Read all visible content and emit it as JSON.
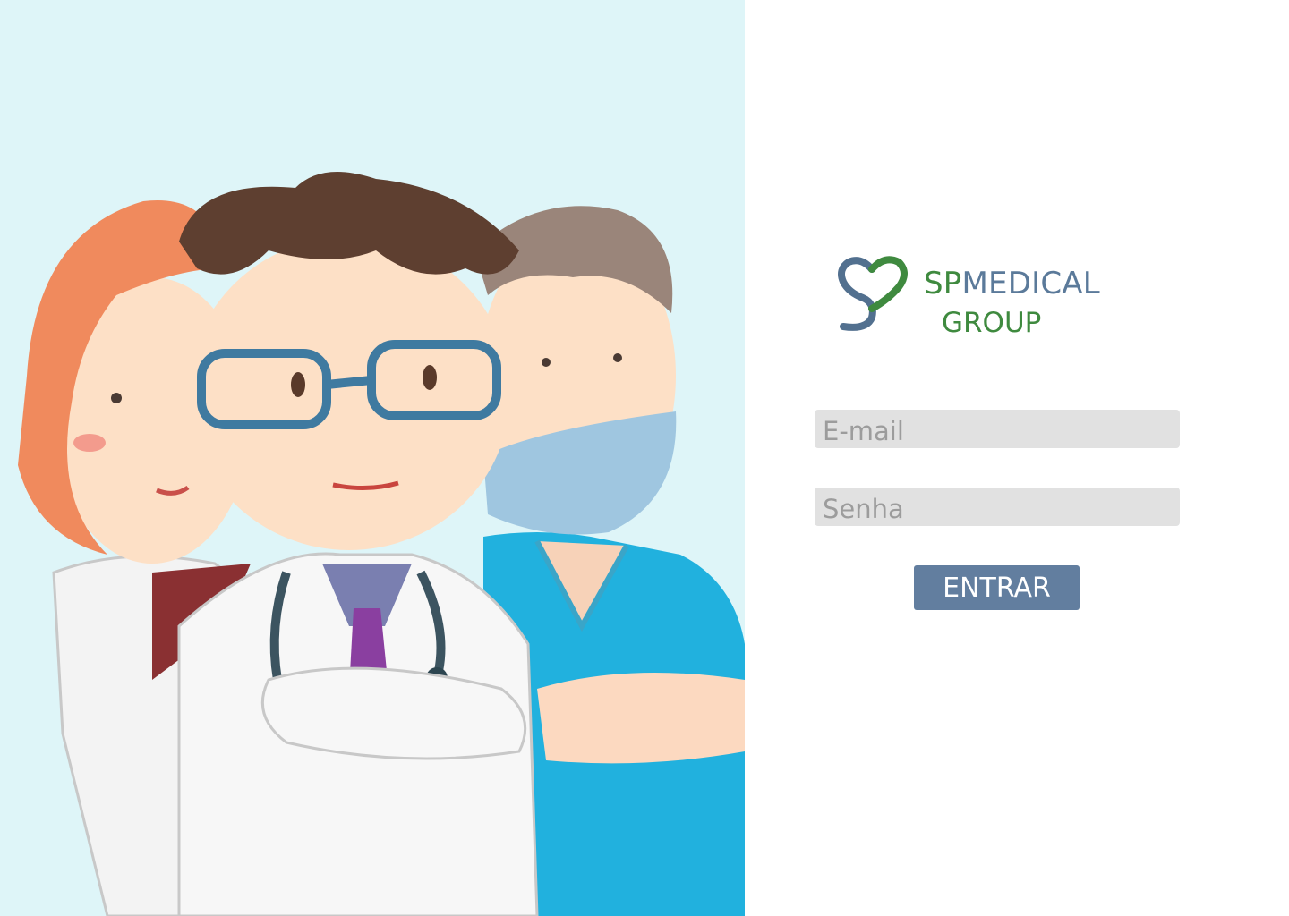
{
  "brand": {
    "name_prefix": "SP",
    "name_rest": "MEDICAL",
    "line2": "GROUP",
    "logo_icon": "heart-s-icon",
    "colors": {
      "green": "#3f8a3f",
      "blue": "#5b7a9a"
    }
  },
  "login": {
    "email_placeholder": "E-mail",
    "password_placeholder": "Senha",
    "submit_label": "ENTRAR"
  },
  "hero": {
    "illustration": "medical-team-illustration",
    "background": "#def5f8"
  },
  "colors": {
    "button": "#627e9f",
    "input_bg": "#e1e1e1"
  }
}
